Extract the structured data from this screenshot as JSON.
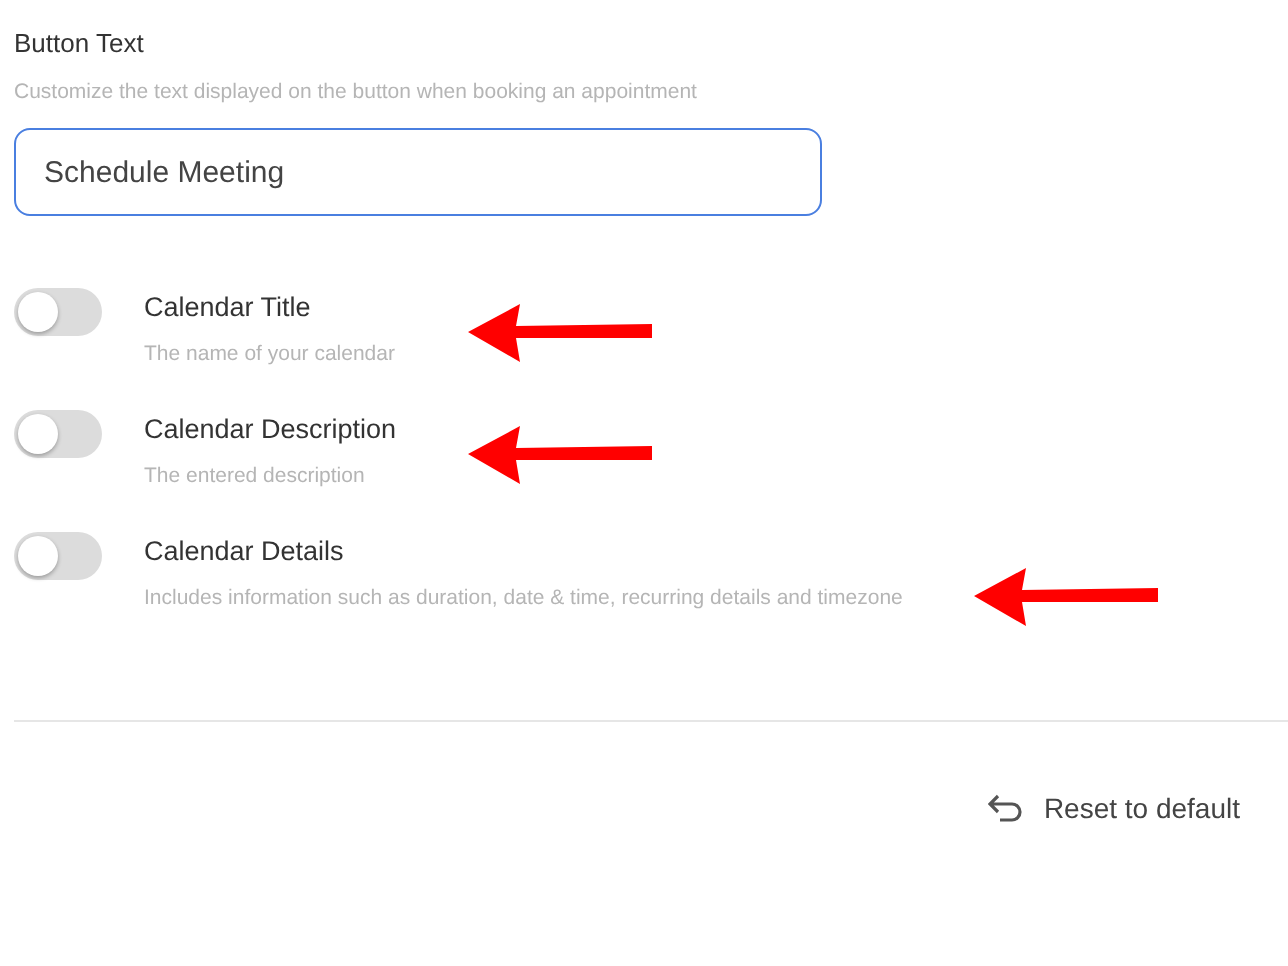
{
  "button_text": {
    "label": "Button Text",
    "description": "Customize the text displayed on the button when booking an appointment",
    "value": "Schedule Meeting"
  },
  "options": [
    {
      "title": "Calendar Title",
      "description": "The name of your calendar",
      "on": false,
      "annotated": true
    },
    {
      "title": "Calendar Description",
      "description": "The entered description",
      "on": false,
      "annotated": true
    },
    {
      "title": "Calendar Details",
      "description": "Includes information such as duration, date & time, recurring details and timezone",
      "on": false,
      "annotated": true
    }
  ],
  "reset_button": "Reset to default"
}
